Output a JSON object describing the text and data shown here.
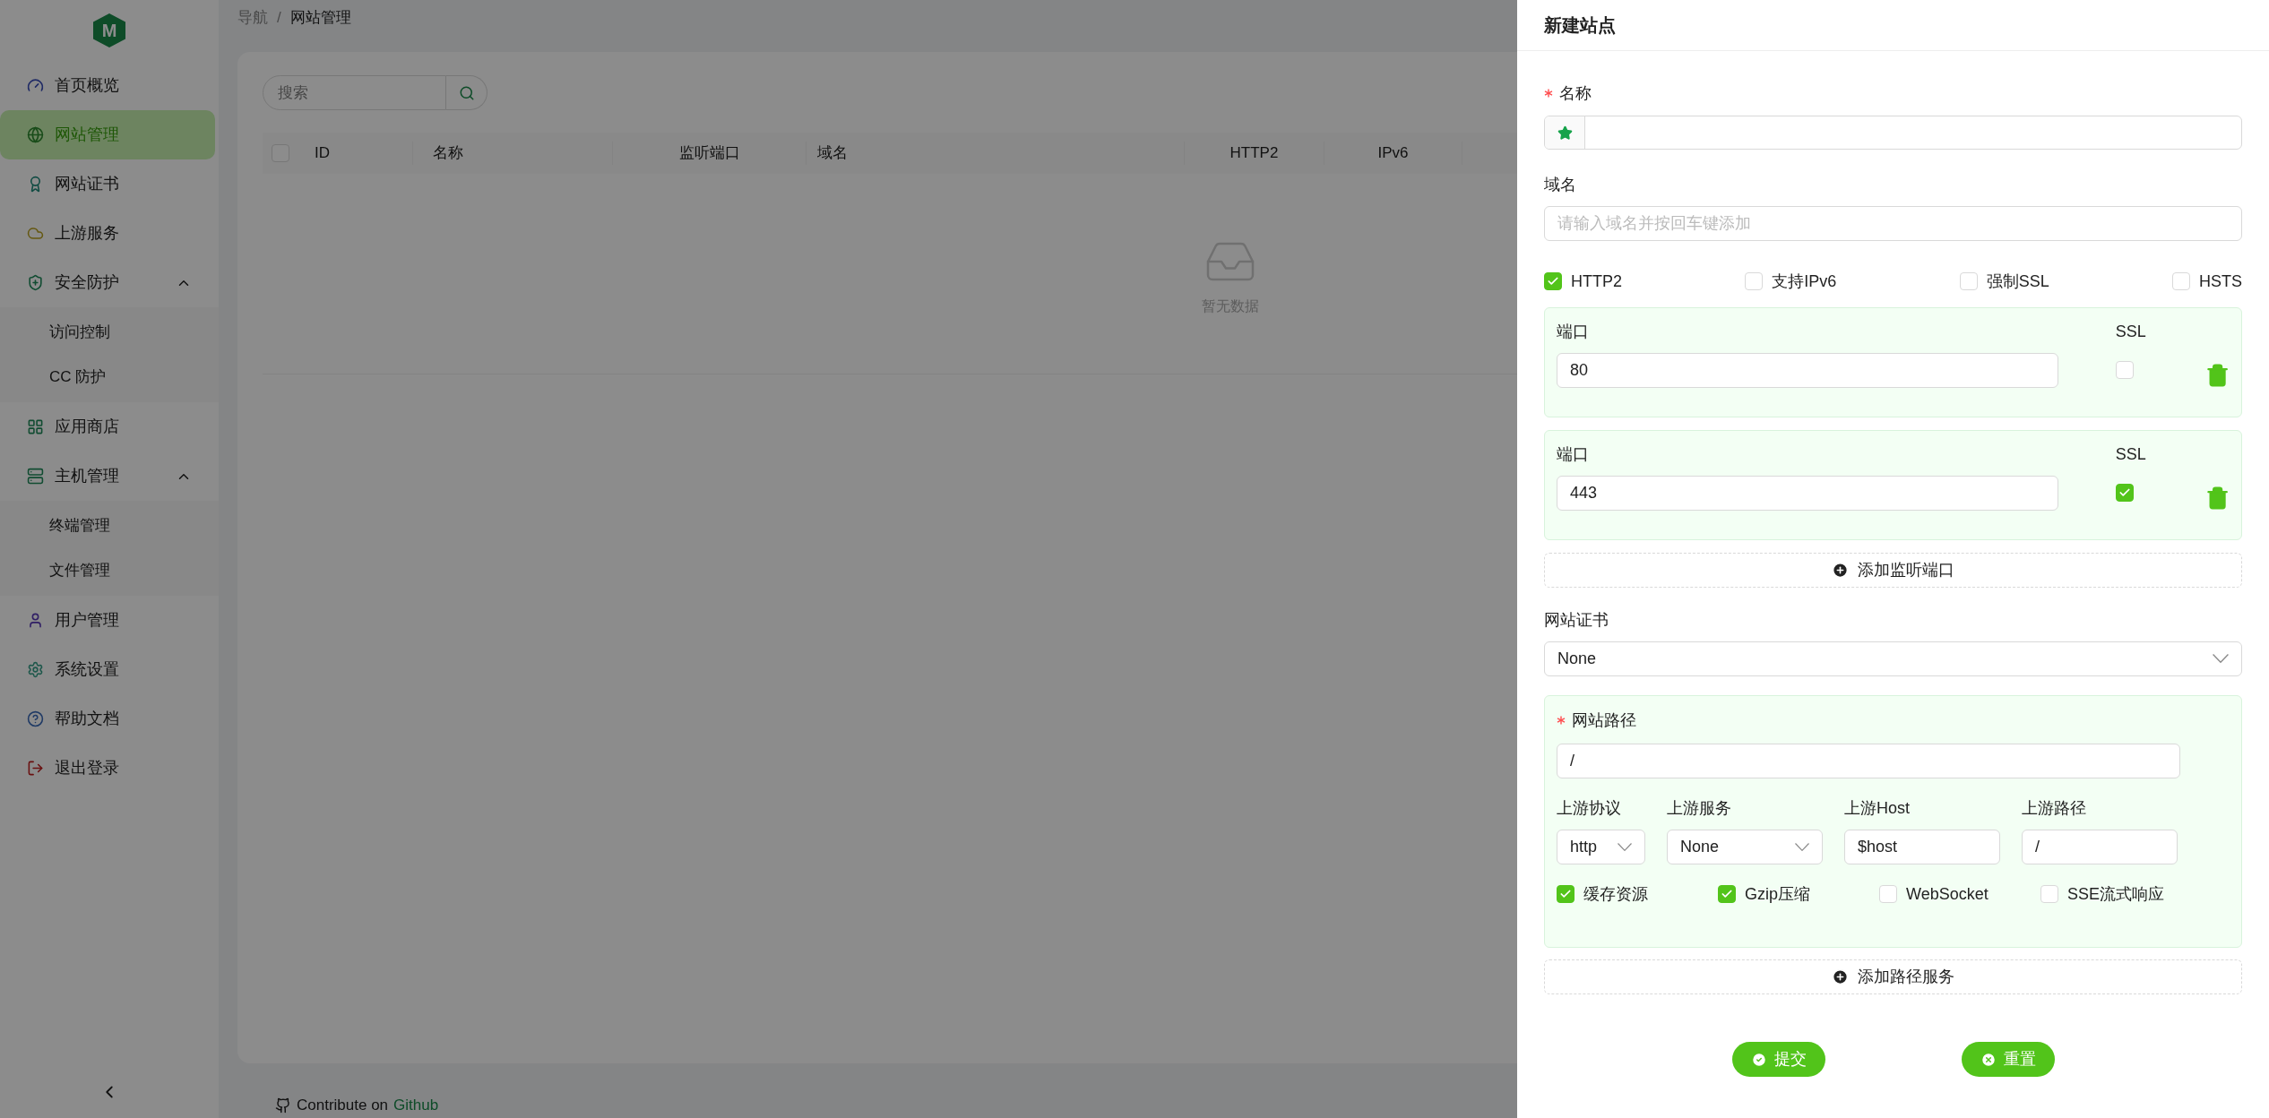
{
  "sidebar": {
    "logo": "M",
    "items": [
      {
        "label": "首页概览",
        "selected": false
      },
      {
        "label": "网站管理",
        "selected": true
      },
      {
        "label": "网站证书",
        "selected": false
      },
      {
        "label": "上游服务",
        "selected": false
      },
      {
        "label": "安全防护",
        "selected": false,
        "expanded": true,
        "children": [
          {
            "label": "访问控制",
            "selected": false
          },
          {
            "label": "CC 防护",
            "selected": false
          }
        ]
      },
      {
        "label": "应用商店",
        "selected": false
      },
      {
        "label": "主机管理",
        "selected": false,
        "expanded": true,
        "children": [
          {
            "label": "终端管理",
            "selected": false
          },
          {
            "label": "文件管理",
            "selected": false
          }
        ]
      },
      {
        "label": "用户管理",
        "selected": false
      },
      {
        "label": "系统设置",
        "selected": false
      },
      {
        "label": "帮助文档",
        "selected": false
      },
      {
        "label": "退出登录",
        "selected": false
      }
    ]
  },
  "breadcrumb": {
    "items": [
      "导航",
      "网站管理"
    ],
    "separator": "/"
  },
  "search": {
    "placeholder": "搜索"
  },
  "table": {
    "select_all": {
      "checked": false
    },
    "columns": [
      "ID",
      "名称",
      "监听端口",
      "域名",
      "HTTP2",
      "IPv6"
    ],
    "empty_text": "暂无数据"
  },
  "footer": {
    "text": "Contribute on",
    "link": "Github"
  },
  "drawer": {
    "title": "新建站点",
    "name": {
      "label": "名称",
      "required": true
    },
    "domain": {
      "label": "域名",
      "placeholder": "请输入域名并按回车键添加"
    },
    "options": [
      {
        "label": "HTTP2",
        "checked": true
      },
      {
        "label": "支持IPv6",
        "checked": false
      },
      {
        "label": "强制SSL",
        "checked": false
      },
      {
        "label": "HSTS",
        "checked": false
      }
    ],
    "ports": [
      {
        "label": "端口",
        "value": "80",
        "ssl_label": "SSL",
        "ssl": false
      },
      {
        "label": "端口",
        "value": "443",
        "ssl_label": "SSL",
        "ssl": true
      }
    ],
    "add_port": "添加监听端口",
    "certificate": {
      "label": "网站证书",
      "value": "None"
    },
    "path": {
      "label": "网站路径",
      "required": true,
      "value": "/",
      "upstream": [
        {
          "label": "上游协议",
          "value": "http",
          "kind": "select"
        },
        {
          "label": "上游服务",
          "value": "None",
          "kind": "select"
        },
        {
          "label": "上游Host",
          "value": "$host",
          "kind": "input"
        },
        {
          "label": "上游路径",
          "value": "/",
          "kind": "input"
        }
      ],
      "options": [
        {
          "label": "缓存资源",
          "checked": true
        },
        {
          "label": "Gzip压缩",
          "checked": true
        },
        {
          "label": "WebSocket",
          "checked": false
        },
        {
          "label": "SSE流式响应",
          "checked": false
        }
      ]
    },
    "add_path": "添加路径服务",
    "buttons": [
      {
        "label": "提交",
        "kind": "submit"
      },
      {
        "label": "重置",
        "kind": "reset"
      }
    ]
  }
}
